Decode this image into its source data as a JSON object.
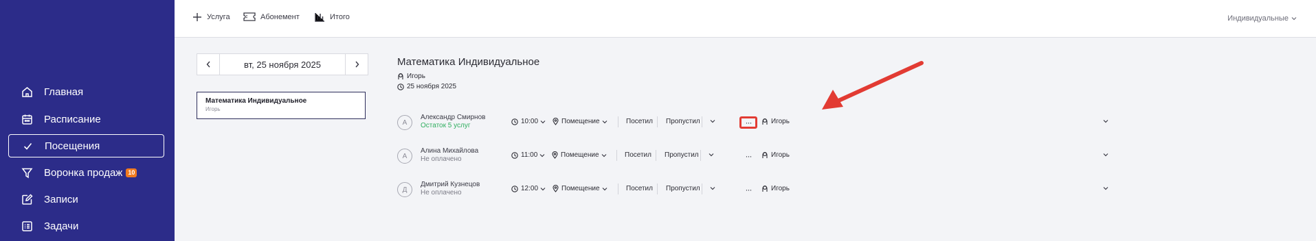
{
  "sidebar": {
    "items": [
      {
        "label": "Главная",
        "icon": "home-icon"
      },
      {
        "label": "Расписание",
        "icon": "calendar-icon"
      },
      {
        "label": "Посещения",
        "icon": "check-icon",
        "active": true
      },
      {
        "label": "Воронка продаж",
        "icon": "funnel-icon",
        "badge": "10"
      },
      {
        "label": "Записи",
        "icon": "edit-icon"
      },
      {
        "label": "Задачи",
        "icon": "task-list-icon"
      }
    ]
  },
  "toolbar": {
    "service_label": "Услуга",
    "subscription_label": "Абонемент",
    "total_label": "Итого",
    "filter_value": "Индивидуальные"
  },
  "date_nav": {
    "date": "вт, 25 ноября 2025"
  },
  "services": [
    {
      "title": "Математика Индивидуальное",
      "teacher": "Игорь"
    }
  ],
  "lesson": {
    "title": "Математика Индивидуальное",
    "teacher": "Игорь",
    "date": "25 ноября 2025"
  },
  "rows": [
    {
      "initial": "А",
      "name": "Александр Смирнов",
      "status": "Остаток 5 услуг",
      "status_type": "green",
      "time": "10:00",
      "room": "Помещение",
      "visit": "Посетил",
      "skip": "Пропустил",
      "more": "···",
      "teacher": "Игорь"
    },
    {
      "initial": "А",
      "name": "Алина Михайлова",
      "status": "Не оплачено",
      "status_type": "grey",
      "time": "11:00",
      "room": "Помещение",
      "visit": "Посетил",
      "skip": "Пропустил",
      "more": "···",
      "teacher": "Игорь"
    },
    {
      "initial": "Д",
      "name": "Дмитрий Кузнецов",
      "status": "Не оплачено",
      "status_type": "grey",
      "time": "12:00",
      "room": "Помещение",
      "visit": "Посетил",
      "skip": "Пропустил",
      "more": "···",
      "teacher": "Игорь"
    }
  ],
  "colors": {
    "sidebar_bg": "#2c2c89",
    "badge": "#f07a1f",
    "status_green": "#2fae5f",
    "annotation_red": "#e23b33"
  }
}
